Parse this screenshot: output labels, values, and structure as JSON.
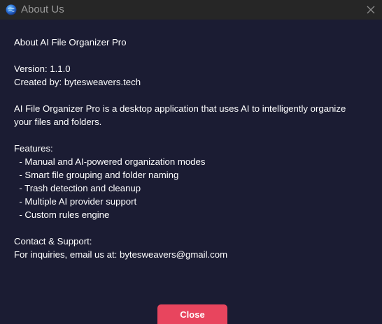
{
  "window": {
    "title": "About Us",
    "icon": "globe-app-icon",
    "close_icon": "close-x-icon"
  },
  "about": {
    "heading": "About AI File Organizer Pro",
    "version": "Version: 1.1.0",
    "created_by": "Created by: bytesweavers.tech",
    "description_lines": [
      "AI File Organizer Pro is a desktop application that uses AI to intelligently organize",
      "your files and folders."
    ],
    "features_heading": "Features:",
    "features": [
      "  - Manual and AI-powered organization modes",
      "  - Smart file grouping and folder naming",
      "  - Trash detection and cleanup",
      "  - Multiple AI provider support",
      "  - Custom rules engine"
    ],
    "contact_heading": "Contact & Support:",
    "contact_line": "For inquiries, email us at: bytesweavers@gmail.com"
  },
  "footer": {
    "close_label": "Close"
  },
  "colors": {
    "background": "#1b1c33",
    "titlebar": "#262626",
    "accent": "#e8455e",
    "text": "#ffffff"
  }
}
